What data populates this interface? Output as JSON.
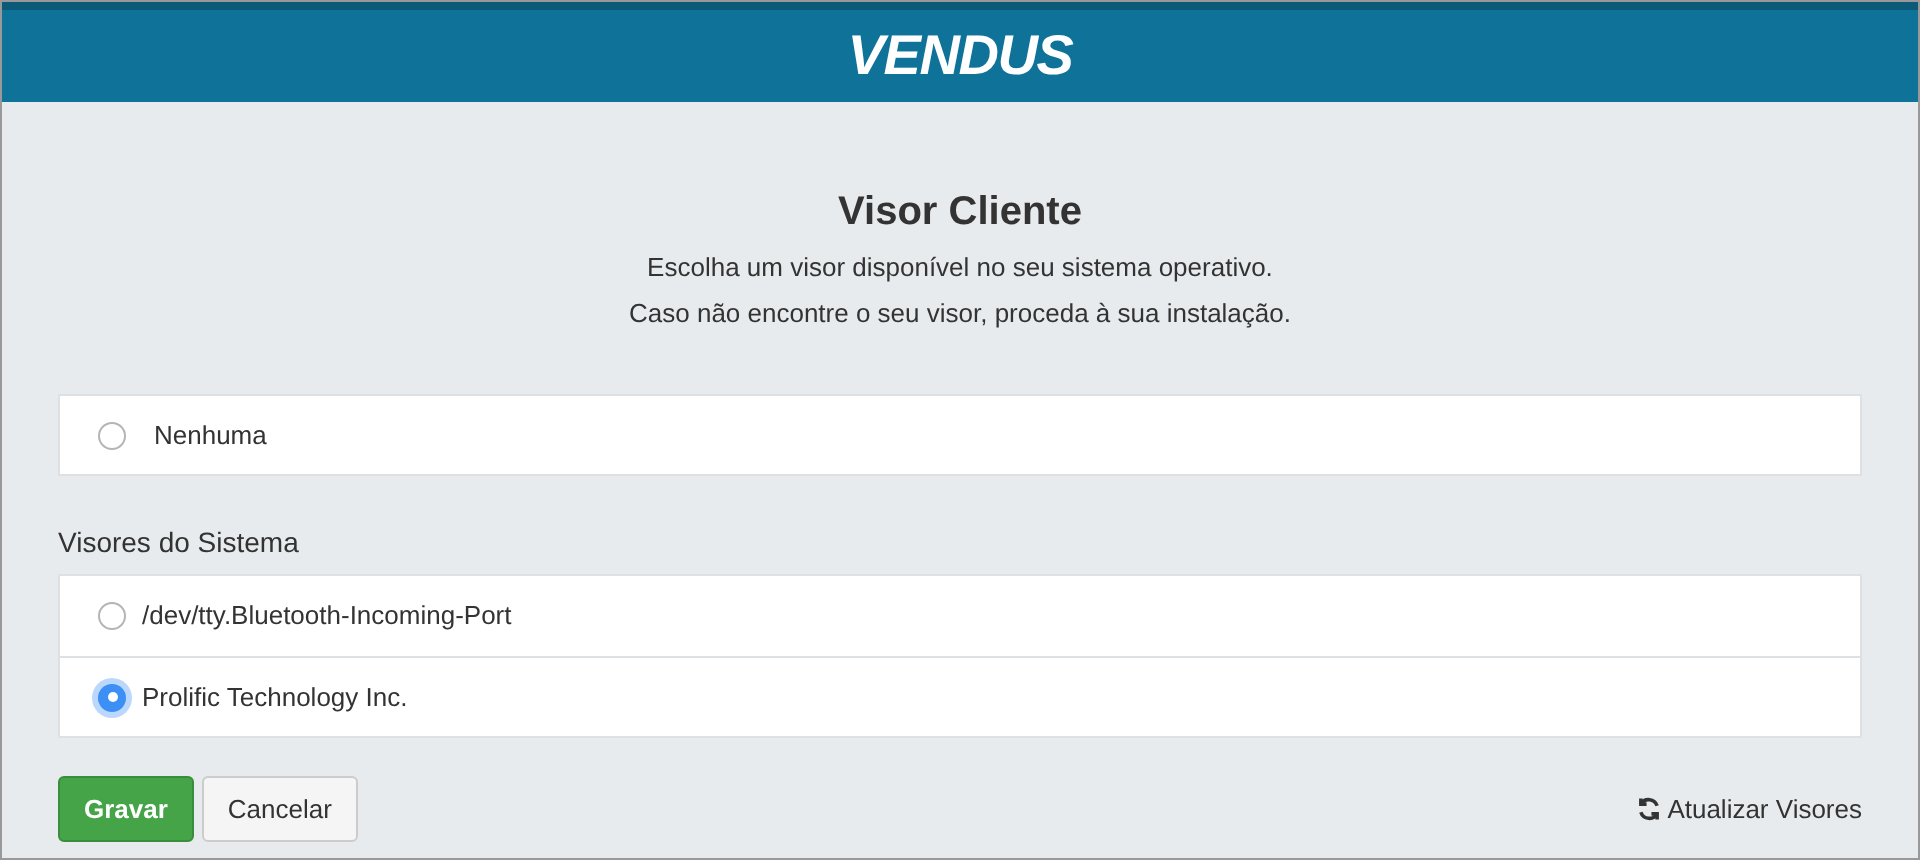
{
  "header": {
    "logo": "VENDUS"
  },
  "title": "Visor Cliente",
  "description": [
    "Escolha um visor disponível no seu sistema operativo.",
    "Caso não encontre o seu visor, proceda à sua instalação."
  ],
  "none_option": {
    "label": "Nenhuma",
    "selected": false
  },
  "system_section": {
    "label": "Visores do Sistema",
    "options": [
      {
        "label": "/dev/tty.Bluetooth-Incoming-Port",
        "selected": false
      },
      {
        "label": "Prolific Technology Inc.",
        "selected": true
      }
    ]
  },
  "buttons": {
    "save": "Gravar",
    "cancel": "Cancelar",
    "refresh": "Atualizar Visores"
  }
}
